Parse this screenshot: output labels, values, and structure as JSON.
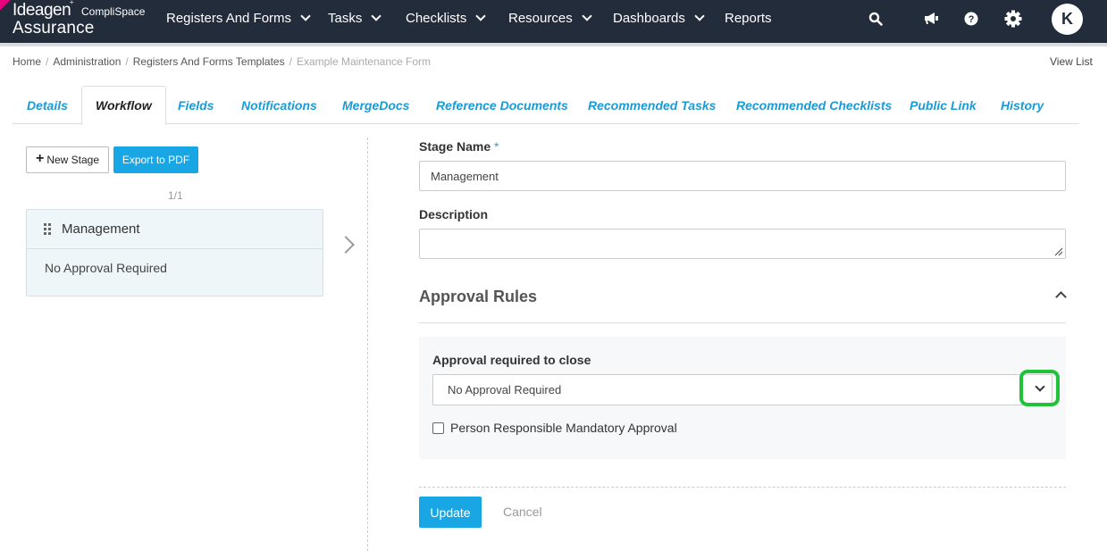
{
  "brand": {
    "logo_main": "Ideagen",
    "logo_sub": "CompliSpace",
    "logo_product": "Assurance"
  },
  "nav": {
    "items": [
      {
        "label": "Registers And Forms",
        "has_dropdown": true
      },
      {
        "label": "Tasks",
        "has_dropdown": true
      },
      {
        "label": "Checklists",
        "has_dropdown": true
      },
      {
        "label": "Resources",
        "has_dropdown": true
      },
      {
        "label": "Dashboards",
        "has_dropdown": true
      },
      {
        "label": "Reports",
        "has_dropdown": false
      }
    ],
    "icons": [
      "search-icon",
      "megaphone-icon",
      "help-icon",
      "gear-icon"
    ],
    "avatar_initial": "K"
  },
  "breadcrumb": {
    "items": [
      "Home",
      "Administration",
      "Registers And Forms Templates"
    ],
    "current": "Example Maintenance Form",
    "view_list": "View List"
  },
  "tabs": [
    {
      "label": "Details",
      "active": false
    },
    {
      "label": "Workflow",
      "active": true
    },
    {
      "label": "Fields",
      "active": false
    },
    {
      "label": "Notifications",
      "active": false
    },
    {
      "label": "MergeDocs",
      "active": false
    },
    {
      "label": "Reference Documents",
      "active": false
    },
    {
      "label": "Recommended Tasks",
      "active": false
    },
    {
      "label": "Recommended Checklists",
      "active": false
    },
    {
      "label": "Public Link",
      "active": false
    },
    {
      "label": "History",
      "active": false
    }
  ],
  "left": {
    "new_stage_label": "New Stage",
    "export_pdf_label": "Export to PDF",
    "pager": "1/1",
    "stage": {
      "name": "Management",
      "approval": "No Approval Required"
    }
  },
  "form": {
    "stage_name_label": "Stage Name",
    "required_marker": "*",
    "stage_name_value": "Management",
    "description_label": "Description",
    "description_value": "",
    "approval_rules_title": "Approval Rules",
    "approval_required_label": "Approval required to close",
    "approval_select_value": "No Approval Required",
    "checkbox_label": "Person Responsible Mandatory Approval",
    "checkbox_checked": false,
    "update_label": "Update",
    "cancel_label": "Cancel"
  },
  "colors": {
    "nav_bg": "#232c3b",
    "accent": "#19a6e5",
    "tab_link": "#1a9bd7",
    "highlight": "#22c13a",
    "ribbon": "#e5007e"
  }
}
